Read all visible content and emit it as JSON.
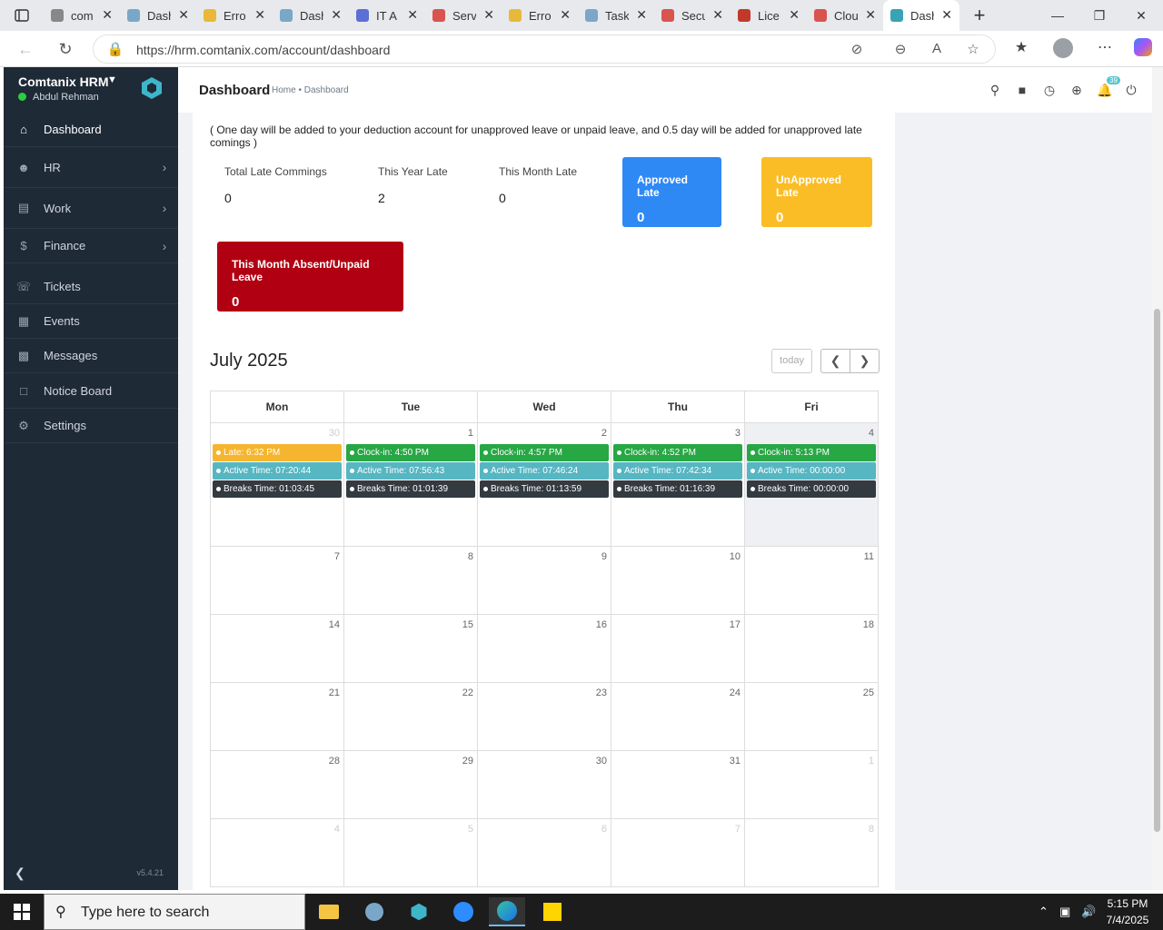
{
  "browser": {
    "tabs": [
      {
        "title": "com",
        "color": "#888888"
      },
      {
        "title": "Dash",
        "color": "#7aa7c7"
      },
      {
        "title": "Erro",
        "color": "#e8b939"
      },
      {
        "title": "Dash",
        "color": "#7aa7c7"
      },
      {
        "title": "IT A",
        "color": "#5b6fd6"
      },
      {
        "title": "Serv",
        "color": "#d9534f"
      },
      {
        "title": "Erro",
        "color": "#e8b939"
      },
      {
        "title": "Task",
        "color": "#7aa7c7"
      },
      {
        "title": "Secu",
        "color": "#d9534f"
      },
      {
        "title": "Lice",
        "color": "#c0392b"
      },
      {
        "title": "Clou",
        "color": "#d9534f"
      },
      {
        "title": "Dash",
        "color": "#37a3b5"
      }
    ],
    "url": "https://hrm.comtanix.com/account/dashboard"
  },
  "sidebar": {
    "brand": "Comtanix HRM",
    "user": "Abdul Rehman",
    "items": [
      {
        "label": "Dashboard",
        "icon": "home-icon",
        "chev": false,
        "active": true
      },
      {
        "label": "HR",
        "icon": "users-icon",
        "chev": true
      },
      {
        "label": "Work",
        "icon": "briefcase-icon",
        "chev": true
      },
      {
        "label": "Finance",
        "icon": "dollar-icon",
        "chev": true
      },
      {
        "label": "Tickets",
        "icon": "headset-icon",
        "chev": false
      },
      {
        "label": "Events",
        "icon": "calendar-icon",
        "chev": false
      },
      {
        "label": "Messages",
        "icon": "message-icon",
        "chev": false
      },
      {
        "label": "Notice Board",
        "icon": "clipboard-icon",
        "chev": false
      },
      {
        "label": "Settings",
        "icon": "gear-icon",
        "chev": false
      }
    ],
    "version": "v5.4.21"
  },
  "header": {
    "title": "Dashboard",
    "breadcrumb": "Home • Dashboard",
    "notif_count": "39"
  },
  "late_info": {
    "note": "( One day will be added to your deduction account for unapproved leave or unpaid leave, and 0.5 day will be added for unapproved late comings )",
    "stats": [
      {
        "label": "Total Late Commings",
        "value": "0"
      },
      {
        "label": "This Year Late",
        "value": "2"
      },
      {
        "label": "This Month Late",
        "value": "0"
      }
    ],
    "approved": {
      "label": "Approved Late",
      "value": "0",
      "color": "#2f89f5"
    },
    "unapproved": {
      "label": "UnApproved Late",
      "value": "0",
      "color": "#fbbd26"
    },
    "absent": {
      "label": "This Month Absent/Unpaid Leave",
      "value": "0",
      "color": "#b10012"
    }
  },
  "calendar": {
    "title": "July 2025",
    "today_label": "today",
    "prev_icon": "chevron-left-icon",
    "next_icon": "chevron-right-icon",
    "days": [
      "Mon",
      "Tue",
      "Wed",
      "Thu",
      "Fri"
    ],
    "weeks": [
      [
        {
          "num": "30",
          "other": true,
          "events": [
            {
              "text": "Late: 6:32 PM",
              "color": "#f6b52e"
            },
            {
              "text": "Active Time: 07:20:44",
              "color": "#56b6c2"
            },
            {
              "text": "Breaks Time: 01:03:45",
              "color": "#333a40"
            }
          ]
        },
        {
          "num": "1",
          "events": [
            {
              "text": "Clock-in: 4:50 PM",
              "color": "#28a745"
            },
            {
              "text": "Active Time: 07:56:43",
              "color": "#56b6c2"
            },
            {
              "text": "Breaks Time: 01:01:39",
              "color": "#333a40"
            }
          ]
        },
        {
          "num": "2",
          "events": [
            {
              "text": "Clock-in: 4:57 PM",
              "color": "#28a745"
            },
            {
              "text": "Active Time: 07:46:24",
              "color": "#56b6c2"
            },
            {
              "text": "Breaks Time: 01:13:59",
              "color": "#333a40"
            }
          ]
        },
        {
          "num": "3",
          "events": [
            {
              "text": "Clock-in: 4:52 PM",
              "color": "#28a745"
            },
            {
              "text": "Active Time: 07:42:34",
              "color": "#56b6c2"
            },
            {
              "text": "Breaks Time: 01:16:39",
              "color": "#333a40"
            }
          ]
        },
        {
          "num": "4",
          "today": true,
          "events": [
            {
              "text": "Clock-in: 5:13 PM",
              "color": "#28a745"
            },
            {
              "text": "Active Time: 00:00:00",
              "color": "#56b6c2"
            },
            {
              "text": "Breaks Time: 00:00:00",
              "color": "#333a40"
            }
          ]
        }
      ],
      [
        {
          "num": "7"
        },
        {
          "num": "8"
        },
        {
          "num": "9"
        },
        {
          "num": "10"
        },
        {
          "num": "11"
        }
      ],
      [
        {
          "num": "14"
        },
        {
          "num": "15"
        },
        {
          "num": "16"
        },
        {
          "num": "17"
        },
        {
          "num": "18"
        }
      ],
      [
        {
          "num": "21"
        },
        {
          "num": "22"
        },
        {
          "num": "23"
        },
        {
          "num": "24"
        },
        {
          "num": "25"
        }
      ],
      [
        {
          "num": "28"
        },
        {
          "num": "29"
        },
        {
          "num": "30"
        },
        {
          "num": "31"
        },
        {
          "num": "1",
          "other": true
        }
      ],
      [
        {
          "num": "4",
          "other": true
        },
        {
          "num": "5",
          "other": true
        },
        {
          "num": "6",
          "other": true
        },
        {
          "num": "7",
          "other": true
        },
        {
          "num": "8",
          "other": true
        }
      ]
    ]
  },
  "taskbar": {
    "search_placeholder": "Type here to search",
    "time": "5:15 PM",
    "date": "7/4/2025"
  }
}
